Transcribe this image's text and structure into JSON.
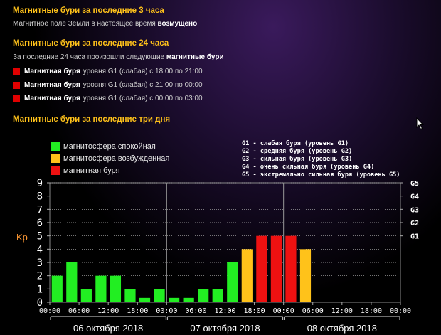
{
  "header3h": {
    "title": "Магнитные бури за последние 3 часа",
    "prefix": "Магнитное поле Земли в настоящее время",
    "state": "возмущено"
  },
  "header24h": {
    "title": "Магнитные бури за последние 24 часа",
    "intro_prefix": "За последние 24 часа произошли следующие",
    "intro_bold": "магнитные бури",
    "storms": [
      {
        "label": "Магнитная буря",
        "text": "уровня G1 (слабая) с 18:00 по 21:00"
      },
      {
        "label": "Магнитная буря",
        "text": "уровня G1 (слабая) с 21:00 по 00:00"
      },
      {
        "label": "Магнитная буря",
        "text": "уровня G1 (слабая) с 00:00 по 03:00"
      }
    ]
  },
  "header3d": {
    "title": "Магнитные бури за последние три дня"
  },
  "legend": [
    {
      "label": "магнитосфера спокойная",
      "color": "#22ee22"
    },
    {
      "label": "магнитосфера возбужденная",
      "color": "#ffc21a"
    },
    {
      "label": "магнитная буря",
      "color": "#ee1111"
    }
  ],
  "g_legend": [
    "G1 - слабая буря (уровень G1)",
    "G2 - средняя буря (уровень G2)",
    "G3 - сильная буря (уровень G3)",
    "G4 - очень сильная буря (уровень G4)",
    "G5 - экстремально сильная буря (уровень G5)"
  ],
  "colors": {
    "quiet": "#22ee22",
    "active": "#ffc21a",
    "storm": "#ee1111",
    "kp_label": "#ff9933"
  },
  "chart_data": {
    "type": "bar",
    "ylabel": "Kp",
    "ylim": [
      0,
      9
    ],
    "yticks": [
      0,
      1,
      2,
      3,
      4,
      5,
      6,
      7,
      8,
      9
    ],
    "g_levels": [
      {
        "label": "G5",
        "kp": 9
      },
      {
        "label": "G4",
        "kp": 8
      },
      {
        "label": "G3",
        "kp": 7
      },
      {
        "label": "G2",
        "kp": 6
      },
      {
        "label": "G1",
        "kp": 5
      }
    ],
    "x_tick_labels": [
      "00:00",
      "06:00",
      "12:00",
      "18:00",
      "00:00",
      "06:00",
      "12:00",
      "18:00",
      "00:00",
      "06:00",
      "12:00",
      "18:00",
      "00:00"
    ],
    "days": [
      "06 октября 2018",
      "07 октября 2018",
      "08 октября 2018"
    ],
    "bars_per_day": 8,
    "bar_hours": 3,
    "values": [
      2,
      3,
      1,
      2,
      2,
      1,
      0.33,
      1,
      0.33,
      0.33,
      1,
      1,
      3,
      4,
      5,
      5,
      5,
      4
    ],
    "states": [
      "quiet",
      "quiet",
      "quiet",
      "quiet",
      "quiet",
      "quiet",
      "quiet",
      "quiet",
      "quiet",
      "quiet",
      "quiet",
      "quiet",
      "quiet",
      "active",
      "storm",
      "storm",
      "storm",
      "active"
    ],
    "grid": true
  }
}
